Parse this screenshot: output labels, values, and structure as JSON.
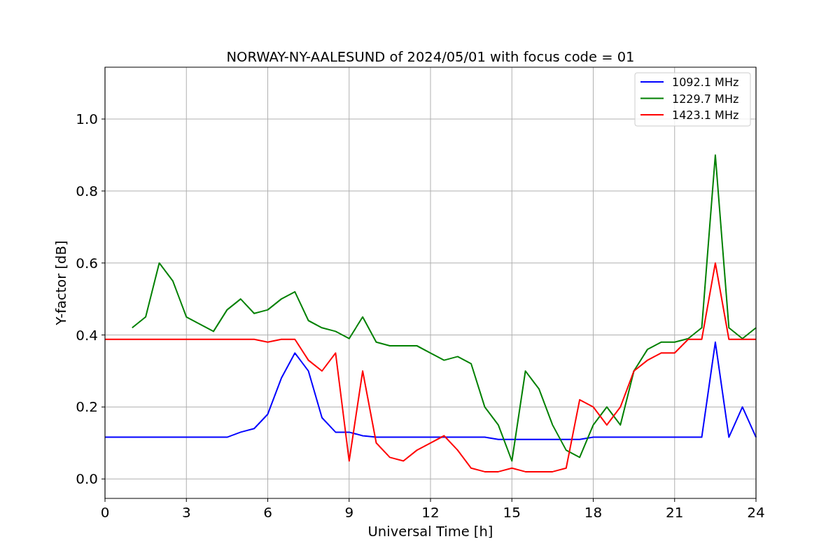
{
  "chart_data": {
    "type": "line",
    "title": "NORWAY-NY-AALESUND of 2024/05/01 with focus code = 01",
    "xlabel": "Universal Time [h]",
    "ylabel": "Y-factor [dB]",
    "x": [
      0,
      0.5,
      1,
      1.5,
      2,
      2.5,
      3,
      3.5,
      4,
      4.5,
      5,
      5.5,
      6,
      6.5,
      7,
      7.5,
      8,
      8.5,
      9,
      9.5,
      10,
      10.5,
      11,
      11.5,
      12,
      12.5,
      13,
      13.5,
      14,
      14.5,
      15,
      15.5,
      16,
      16.5,
      17,
      17.5,
      18,
      18.5,
      19,
      19.5,
      20,
      20.5,
      21,
      21.5,
      22,
      22.5,
      23,
      23.5,
      24
    ],
    "series": [
      {
        "name": "1092.1 MHz",
        "color": "#0000ff",
        "values": [
          0.116,
          0.116,
          0.116,
          0.116,
          0.116,
          0.116,
          0.116,
          0.116,
          0.116,
          0.116,
          0.13,
          0.14,
          0.18,
          0.28,
          0.35,
          0.3,
          0.17,
          0.13,
          0.13,
          0.12,
          0.116,
          0.116,
          0.116,
          0.116,
          0.116,
          0.116,
          0.116,
          0.116,
          0.116,
          0.11,
          0.11,
          0.11,
          0.11,
          0.11,
          0.11,
          0.11,
          0.116,
          0.116,
          0.116,
          0.116,
          0.116,
          0.116,
          0.116,
          0.116,
          0.116,
          0.38,
          0.116,
          0.2,
          0.116
        ]
      },
      {
        "name": "1229.7 MHz",
        "color": "#008000",
        "values": [
          null,
          null,
          0.42,
          0.45,
          0.6,
          0.55,
          0.45,
          0.43,
          0.41,
          0.47,
          0.5,
          0.46,
          0.47,
          0.5,
          0.52,
          0.44,
          0.42,
          0.41,
          0.39,
          0.45,
          0.38,
          0.37,
          0.37,
          0.37,
          0.35,
          0.33,
          0.34,
          0.32,
          0.2,
          0.15,
          0.05,
          0.3,
          0.25,
          0.15,
          0.08,
          0.06,
          0.15,
          0.2,
          0.15,
          0.3,
          0.36,
          0.38,
          0.38,
          0.39,
          0.42,
          0.9,
          0.42,
          0.39,
          0.42
        ]
      },
      {
        "name": "1423.1 MHz",
        "color": "#ff0000",
        "values": [
          0.388,
          0.388,
          0.388,
          0.388,
          0.388,
          0.388,
          0.388,
          0.388,
          0.388,
          0.388,
          0.388,
          0.388,
          0.38,
          0.388,
          0.388,
          0.33,
          0.3,
          0.35,
          0.05,
          0.3,
          0.1,
          0.06,
          0.05,
          0.08,
          0.1,
          0.12,
          0.08,
          0.03,
          0.02,
          0.02,
          0.03,
          0.02,
          0.02,
          0.02,
          0.03,
          0.22,
          0.2,
          0.15,
          0.2,
          0.3,
          0.33,
          0.35,
          0.35,
          0.388,
          0.388,
          0.6,
          0.388,
          0.388,
          0.388
        ]
      }
    ],
    "grid": true,
    "legend": true,
    "xlim": [
      0,
      24
    ],
    "ylim": [
      -0.054,
      1.144
    ],
    "xticks": [
      0,
      3,
      6,
      9,
      12,
      15,
      18,
      21,
      24
    ],
    "yticks": [
      {
        "value": 0,
        "label": "0.0"
      },
      {
        "value": 0.2,
        "label": "0.2"
      },
      {
        "value": 0.4,
        "label": "0.4"
      },
      {
        "value": 0.6,
        "label": "0.6"
      },
      {
        "value": 0.8,
        "label": "0.8"
      },
      {
        "value": 1,
        "label": "1.0"
      }
    ]
  }
}
